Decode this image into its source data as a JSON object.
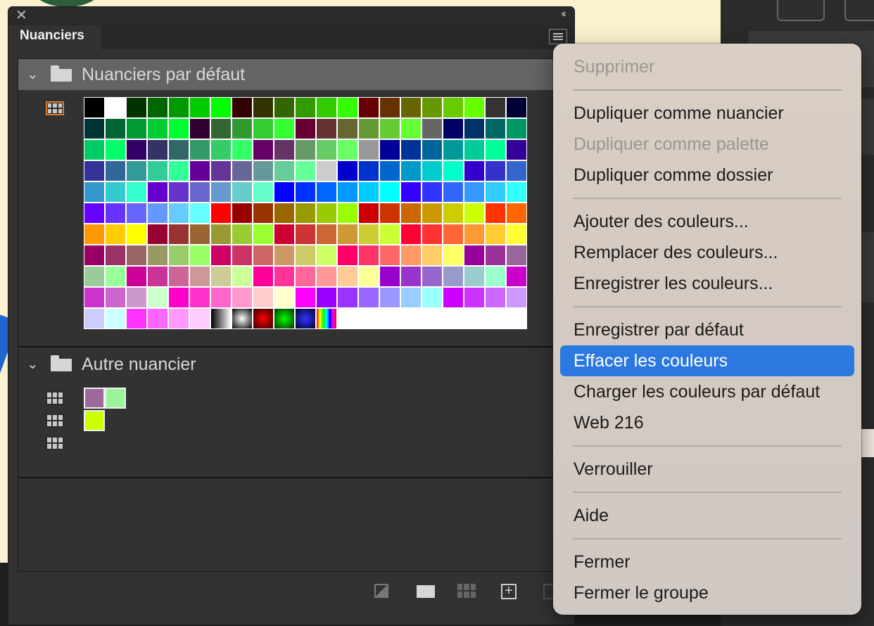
{
  "panel": {
    "tab_label": "Nuanciers",
    "close_glyph": "✕",
    "collapse_glyph": "‹‹"
  },
  "groups": [
    {
      "title": "Nuanciers par défaut"
    },
    {
      "title": "Autre nuancier"
    }
  ],
  "default_swatches": [
    "#000000",
    "#ffffff",
    "#003300",
    "#006600",
    "#009900",
    "#00cc00",
    "#00ff00",
    "#330000",
    "#333300",
    "#336600",
    "#339900",
    "#33cc00",
    "#33ff00",
    "#660000",
    "#663300",
    "#666600",
    "#669900",
    "#66cc00",
    "#66ff00",
    "#333333",
    "#000033",
    "#003333",
    "#006633",
    "#009933",
    "#00cc33",
    "#00ff33",
    "#330033",
    "#336633",
    "#339933",
    "#33cc33",
    "#33ff33",
    "#660033",
    "#663333",
    "#666633",
    "#669933",
    "#66cc33",
    "#66ff33",
    "#666666",
    "#000066",
    "#003366",
    "#006666",
    "#009966",
    "#00cc66",
    "#00ff66",
    "#330066",
    "#333366",
    "#336666",
    "#339966",
    "#33cc66",
    "#33ff66",
    "#660066",
    "#663366",
    "#669966",
    "#66cc66",
    "#66ff66",
    "#999999",
    "#000099",
    "#003399",
    "#006699",
    "#009999",
    "#00cc99",
    "#00ff99",
    "#330099",
    "#333399",
    "#336699",
    "#339999",
    "#33cc99",
    "#33ff99",
    "#660099",
    "#663399",
    "#666699",
    "#669999",
    "#66cc99",
    "#66ff99",
    "#cccccc",
    "#0000cc",
    "#0033cc",
    "#0066cc",
    "#0099cc",
    "#00cccc",
    "#00ffcc",
    "#3300cc",
    "#3333cc",
    "#3366cc",
    "#3399cc",
    "#33cccc",
    "#33ffcc",
    "#6600cc",
    "#6633cc",
    "#6666cc",
    "#6699cc",
    "#66cccc",
    "#66ffcc",
    "#0000ff",
    "#0033ff",
    "#0066ff",
    "#0099ff",
    "#00ccff",
    "#00ffff",
    "#3300ff",
    "#3333ff",
    "#3366ff",
    "#3399ff",
    "#33ccff",
    "#33ffff",
    "#6600ff",
    "#6633ff",
    "#6666ff",
    "#6699ff",
    "#66ccff",
    "#66ffff",
    "#ff0000",
    "#990000",
    "#993300",
    "#996600",
    "#999900",
    "#99cc00",
    "#99ff00",
    "#cc0000",
    "#cc3300",
    "#cc6600",
    "#cc9900",
    "#cccc00",
    "#ccff00",
    "#ff3300",
    "#ff6600",
    "#ff9900",
    "#ffcc00",
    "#ffff00",
    "#990033",
    "#993333",
    "#996633",
    "#999933",
    "#99cc33",
    "#99ff33",
    "#cc0033",
    "#cc3333",
    "#cc6633",
    "#cc9933",
    "#cccc33",
    "#ccff33",
    "#ff0033",
    "#ff3333",
    "#ff6633",
    "#ff9933",
    "#ffcc33",
    "#ffff33",
    "#990066",
    "#993366",
    "#996666",
    "#999966",
    "#99cc66",
    "#99ff66",
    "#cc0066",
    "#cc3366",
    "#cc6666",
    "#cc9966",
    "#cccc66",
    "#ccff66",
    "#ff0066",
    "#ff3366",
    "#ff6666",
    "#ff9966",
    "#ffcc66",
    "#ffff66",
    "#990099",
    "#993399",
    "#996699",
    "#99cc99",
    "#99ff99",
    "#cc0099",
    "#cc3399",
    "#cc6699",
    "#cc9999",
    "#cccc99",
    "#ccff99",
    "#ff0099",
    "#ff3399",
    "#ff6699",
    "#ff9999",
    "#ffcc99",
    "#ffff99",
    "#9900cc",
    "#9933cc",
    "#9966cc",
    "#9999cc",
    "#99cccc",
    "#99ffcc",
    "#cc00cc",
    "#cc33cc",
    "#cc66cc",
    "#cc99cc",
    "#ccffcc",
    "#ff00cc",
    "#ff33cc",
    "#ff66cc",
    "#ff99cc",
    "#ffcccc",
    "#ffffcc",
    "#ff00ff",
    "#9900ff",
    "#9933ff",
    "#9966ff",
    "#9999ff",
    "#99ccff",
    "#99ffff",
    "#cc00ff",
    "#cc33ff",
    "#cc66ff",
    "#cc99ff",
    "#ccccff",
    "#ccffff",
    "#ff33ff",
    "#ff66ff",
    "#ff99ff",
    "#ffccff"
  ],
  "gradient_swatches": [
    "linear-black-white",
    "radial-white-black",
    "radial-red",
    "radial-green",
    "radial-blue",
    "linear-rainbow"
  ],
  "other_swatches": [
    [
      "#9b6a9b",
      "#99f599"
    ],
    [
      "#ccff00"
    ],
    []
  ],
  "bottom_icons": [
    "swatch-new-icon",
    "folder-icon",
    "grid-icon",
    "add-icon",
    "trash-icon"
  ],
  "menu": {
    "items": [
      {
        "label": "Supprimer",
        "disabled": true
      },
      {
        "sep": true
      },
      {
        "label": "Dupliquer comme nuancier"
      },
      {
        "label": "Dupliquer comme palette",
        "disabled": true
      },
      {
        "label": "Dupliquer comme dossier"
      },
      {
        "sep": true
      },
      {
        "label": "Ajouter des couleurs..."
      },
      {
        "label": "Remplacer des couleurs..."
      },
      {
        "label": "Enregistrer les couleurs..."
      },
      {
        "sep": true
      },
      {
        "label": "Enregistrer par défaut"
      },
      {
        "label": "Effacer les couleurs",
        "highlighted": true
      },
      {
        "label": "Charger les couleurs par défaut"
      },
      {
        "label": "Web 216"
      },
      {
        "sep": true
      },
      {
        "label": "Verrouiller"
      },
      {
        "sep": true
      },
      {
        "label": "Aide"
      },
      {
        "sep": true
      },
      {
        "label": "Fermer"
      },
      {
        "label": "Fermer le groupe"
      }
    ]
  },
  "colors": {
    "highlight": "#2c78e1",
    "active_outline": "#e07a2c",
    "panel_bg": "#323232"
  }
}
